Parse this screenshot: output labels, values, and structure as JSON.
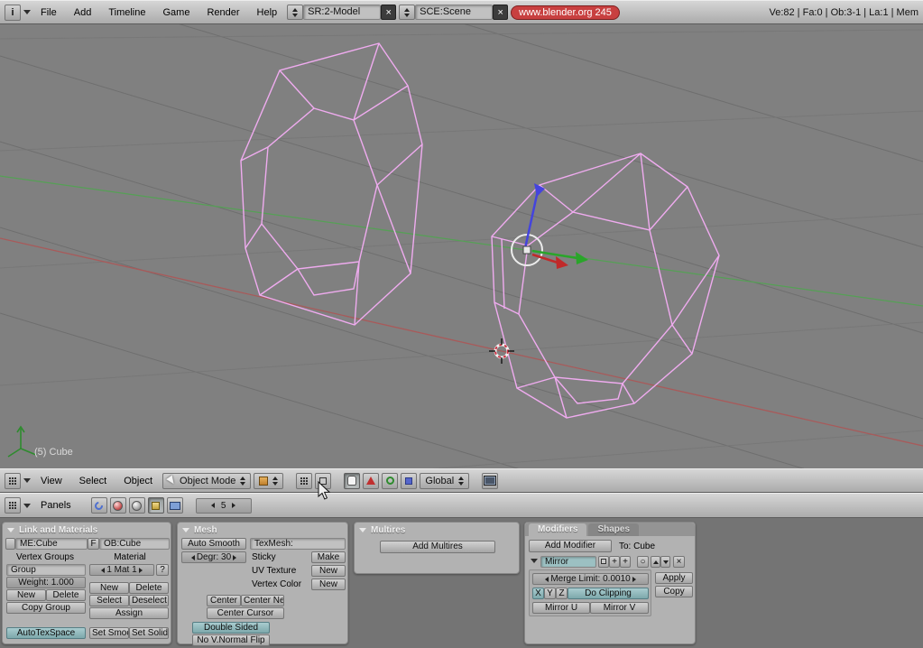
{
  "colors": {
    "accent_teal": "#7da8ab",
    "wireframe_pink": "#efabef",
    "axis_red": "#a85a5a",
    "axis_green": "#55a055",
    "badge_red": "#c84040",
    "viewport_gray": "#808080"
  },
  "icons": {
    "window_info": "i",
    "close_x": "×",
    "plus": "+",
    "circle": "○"
  },
  "top_header": {
    "menus": [
      "File",
      "Add",
      "Timeline",
      "Game",
      "Render",
      "Help"
    ],
    "screen_value": "SR:2-Model",
    "scene_value": "SCE:Scene",
    "version_badge": "www.blender.org 245",
    "stats": "Ve:82 | Fa:0 | Ob:3-1 | La:1 | Mem"
  },
  "viewport": {
    "object_label": "(5) Cube"
  },
  "viewport_header": {
    "menus": [
      "View",
      "Select",
      "Object"
    ],
    "mode": "Object Mode",
    "orientation": "Global"
  },
  "buttons_header": {
    "panels_menu": "Panels",
    "context_number": "5"
  },
  "panel_link": {
    "title": "Link and Materials",
    "me_value": "ME:Cube",
    "f_button": "F",
    "ob_value": "OB:Cube",
    "vertex_groups_label": "Vertex Groups",
    "material_label": "Material",
    "group_value": "Group",
    "mat_value": "1 Mat 1",
    "help_button": "?",
    "weight_value": "Weight: 1.000",
    "new_button": "New",
    "delete_button": "Delete",
    "copy_group_button": "Copy Group",
    "select_button": "Select",
    "deselect_button": "Deselect",
    "assign_button": "Assign",
    "autotex_button": "AutoTexSpace",
    "set_smooth_button": "Set Smoot",
    "set_solid_button": "Set Solid"
  },
  "panel_mesh": {
    "title": "Mesh",
    "auto_smooth_button": "Auto Smooth",
    "degr_value": "Degr: 30",
    "texmesh_label": "TexMesh:",
    "sticky_label": "Sticky",
    "make_button": "Make",
    "uv_texture_label": "UV Texture",
    "uv_new_button": "New",
    "vertex_color_label": "Vertex Color",
    "vc_new_button": "New",
    "center_button": "Center",
    "center_new_button": "Center New",
    "center_cursor_button": "Center Cursor",
    "double_sided_button": "Double Sided",
    "no_vnormal_button": "No V.Normal Flip"
  },
  "panel_multires": {
    "title": "Multires",
    "add_button": "Add Multires"
  },
  "panel_modifiers": {
    "tab_modifiers": "Modifiers",
    "tab_shapes": "Shapes",
    "add_modifier_button": "Add Modifier",
    "to_label": "To: Cube",
    "modifier_name": "Mirror",
    "apply_button": "Apply",
    "copy_button": "Copy",
    "merge_limit_value": "Merge Limit: 0.0010",
    "axis_x": "X",
    "axis_y": "Y",
    "axis_z": "Z",
    "do_clipping_button": "Do Clipping",
    "mirror_u_button": "Mirror U",
    "mirror_v_button": "Mirror V"
  }
}
